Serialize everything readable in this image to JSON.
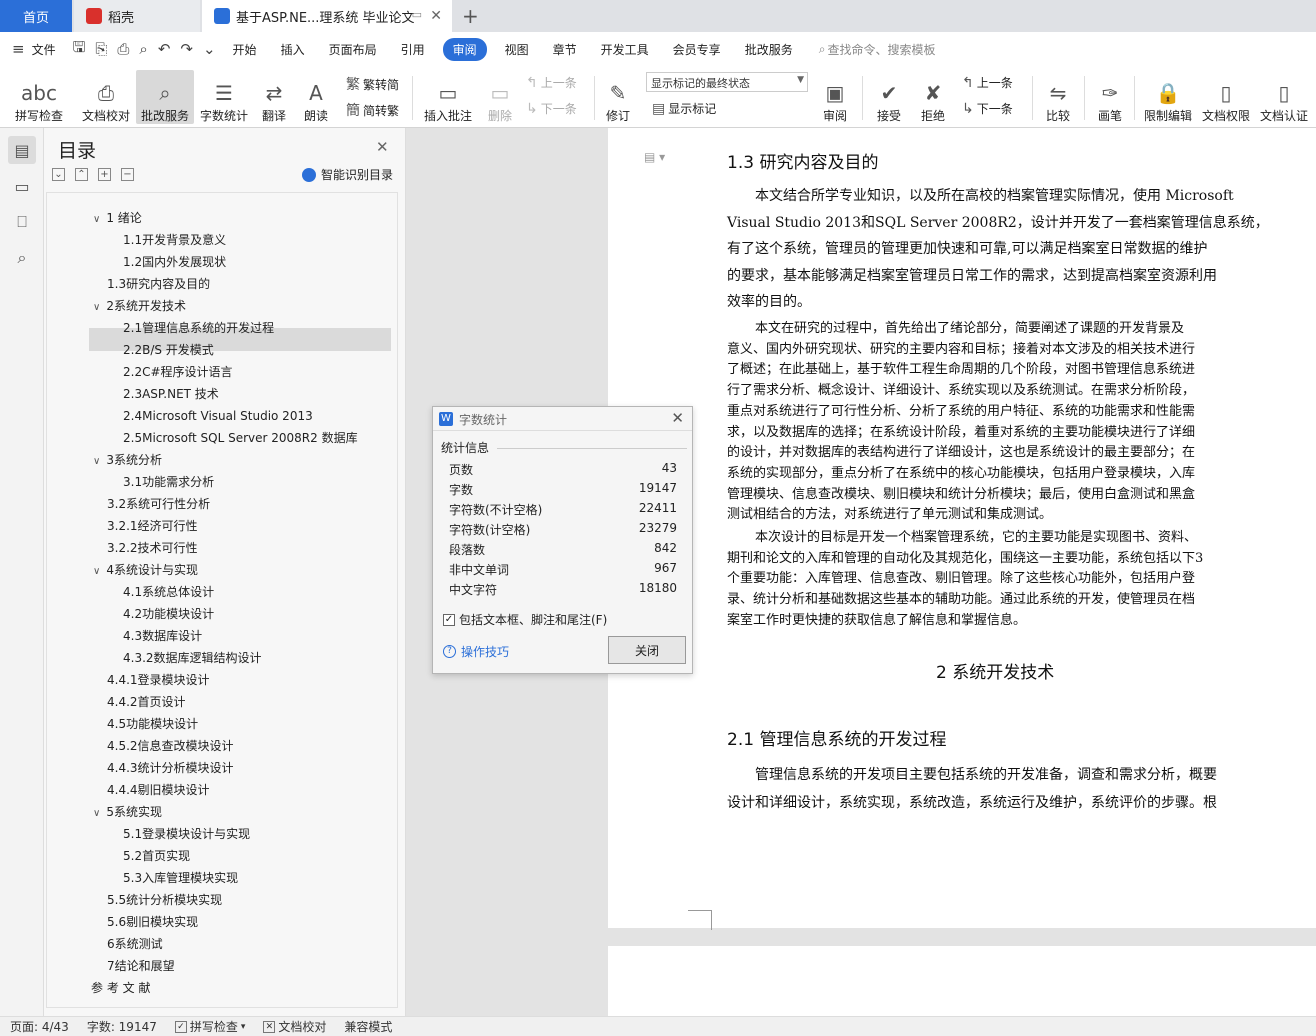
{
  "tabs": {
    "home": "首页",
    "daoke": "稻壳",
    "doc": "基于ASP.NE...理系统 毕业论文"
  },
  "menu": {
    "file": "文件",
    "items": [
      "开始",
      "插入",
      "页面布局",
      "引用",
      "审阅",
      "视图",
      "章节",
      "开发工具",
      "会员专享",
      "批改服务"
    ],
    "active": "审阅",
    "search": "查找命令、搜索模板"
  },
  "ribbon": {
    "spellcheck": "拼写检查",
    "doccheck": "文档校对",
    "correction": "批改服务",
    "wordcount": "字数统计",
    "translate": "翻译",
    "read": "朗读",
    "trad": "繁转简",
    "simp": "简转繁",
    "insert_comment": "插入批注",
    "delete": "删除",
    "prev": "上一条",
    "next": "下一条",
    "revise": "修订",
    "markup_select": "显示标记的最终状态",
    "show_markup": "显示标记",
    "review": "审阅",
    "accept": "接受",
    "reject": "拒绝",
    "prev2": "上一条",
    "next2": "下一条",
    "compare": "比较",
    "pen": "画笔",
    "restrict": "限制编辑",
    "perm": "文档权限",
    "auth": "文档认证"
  },
  "toc": {
    "title": "目录",
    "smart": "智能识别目录",
    "items": [
      {
        "text": "1 绪论",
        "level": 1,
        "caret": true
      },
      {
        "text": "1.1开发背景及意义",
        "level": 2
      },
      {
        "text": "1.2国内外发展现状",
        "level": 2
      },
      {
        "text": "1.3研究内容及目的",
        "level": 1
      },
      {
        "text": "2系统开发技术",
        "level": 1,
        "caret": true
      },
      {
        "text": "2.1管理信息系统的开发过程",
        "level": 2
      },
      {
        "text": "2.2B/S 开发模式",
        "level": 2
      },
      {
        "text": "2.2C#程序设计语言",
        "level": 2
      },
      {
        "text": "2.3ASP.NET 技术",
        "level": 2
      },
      {
        "text": "2.4Microsoft Visual Studio 2013",
        "level": 2
      },
      {
        "text": "2.5Microsoft SQL Server 2008R2 数据库",
        "level": 2
      },
      {
        "text": "3系统分析",
        "level": 1,
        "caret": true
      },
      {
        "text": "3.1功能需求分析",
        "level": 2
      },
      {
        "text": "3.2系统可行性分析",
        "level": 1
      },
      {
        "text": "3.2.1经济可行性",
        "level": 1
      },
      {
        "text": "3.2.2技术可行性",
        "level": 1
      },
      {
        "text": "4系统设计与实现",
        "level": 1,
        "caret": true
      },
      {
        "text": "4.1系统总体设计",
        "level": 2
      },
      {
        "text": "4.2功能模块设计",
        "level": 2
      },
      {
        "text": "4.3数据库设计",
        "level": 2
      },
      {
        "text": "4.3.2数据库逻辑结构设计",
        "level": 2
      },
      {
        "text": "4.4.1登录模块设计",
        "level": 1
      },
      {
        "text": "4.4.2首页设计",
        "level": 1
      },
      {
        "text": "4.5功能模块设计",
        "level": 1
      },
      {
        "text": "4.5.2信息查改模块设计",
        "level": 1
      },
      {
        "text": "4.4.3统计分析模块设计",
        "level": 1
      },
      {
        "text": "4.4.4剔旧模块设计",
        "level": 1
      },
      {
        "text": "5系统实现",
        "level": 1,
        "caret": true
      },
      {
        "text": "5.1登录模块设计与实现",
        "level": 2
      },
      {
        "text": "5.2首页实现",
        "level": 2
      },
      {
        "text": "5.3入库管理模块实现",
        "level": 2
      },
      {
        "text": "5.5统计分析模块实现",
        "level": 1
      },
      {
        "text": "5.6剔旧模块实现",
        "level": 1
      },
      {
        "text": "6系统测试",
        "level": 1
      },
      {
        "text": "7结论和展望",
        "level": 1
      },
      {
        "text": "参 考 文 献",
        "level": 0
      }
    ]
  },
  "document": {
    "heading_13": "1.3  研究内容及目的",
    "p1_lines": [
      "本文结合所学专业知识，以及所在高校的档案管理实际情况，使用 Microsoft",
      "Visual Studio 2013和SQL Server 2008R2，设计并开发了一套档案管理信息系统，",
      "有了这个系统，管理员的管理更加快速和可靠,可以满足档案室日常数据的维护",
      "的要求，基本能够满足档案室管理员日常工作的需求，达到提高档案室资源利用",
      "效率的目的。"
    ],
    "p2_lines": [
      "本文在研究的过程中，首先给出了绪论部分，简要阐述了课题的开发背景及",
      "意义、国内外研究现状、研究的主要内容和目标；接着对本文涉及的相关技术进行",
      "了概述；在此基础上，基于软件工程生命周期的几个阶段，对图书管理信息系统进",
      "行了需求分析、概念设计、详细设计、系统实现以及系统测试。在需求分析阶段，",
      "重点对系统进行了可行性分析、分析了系统的用户特征、系统的功能需求和性能需",
      "求，以及数据库的选择；在系统设计阶段，着重对系统的主要功能模块进行了详细",
      "的设计，并对数据库的表结构进行了详细设计，这也是系统设计的最主要部分；在",
      "系统的实现部分，重点分析了在系统中的核心功能模块，包括用户登录模块，入库",
      "管理模块、信息查改模块、剔旧模块和统计分析模块；最后，使用白盒测试和黑盒",
      "测试相结合的方法，对系统进行了单元测试和集成测试。"
    ],
    "p3_lines": [
      "本次设计的目标是开发一个档案管理系统，它的主要功能是实现图书、资料、",
      "期刊和论文的入库和管理的自动化及其规范化，围绕这一主要功能，系统包括以下3",
      "个重要功能：入库管理、信息查改、剔旧管理。除了这些核心功能外，包括用户登",
      "录、统计分析和基础数据这些基本的辅助功能。通过此系统的开发，使管理员在档",
      "案室工作时更快捷的获取信息了解信息和掌握信息。"
    ],
    "heading_2": "2 系统开发技术",
    "heading_21": "2.1  管理信息系统的开发过程",
    "p4_lines": [
      "管理信息系统的开发项目主要包括系统的开发准备，调查和需求分析，概要",
      "设计和详细设计，系统实现，系统改造，系统运行及维护，系统评价的步骤。根"
    ]
  },
  "dialog": {
    "title": "字数统计",
    "section": "统计信息",
    "rows": [
      {
        "label": "页数",
        "value": "43"
      },
      {
        "label": "字数",
        "value": "19147"
      },
      {
        "label": "字符数(不计空格)",
        "value": "22411"
      },
      {
        "label": "字符数(计空格)",
        "value": "23279"
      },
      {
        "label": "段落数",
        "value": "842"
      },
      {
        "label": "非中文单词",
        "value": "967"
      },
      {
        "label": "中文字符",
        "value": "18180"
      }
    ],
    "checkbox": "包括文本框、脚注和尾注(F)",
    "tips": "操作技巧",
    "close": "关闭"
  },
  "status": {
    "page": "页面: 4/43",
    "words": "字数: 19147",
    "spell": "拼写检查",
    "proof": "文档校对",
    "compat": "兼容模式"
  },
  "colors": {
    "accent": "#2b6fd8",
    "daoke": "#d9302c"
  }
}
